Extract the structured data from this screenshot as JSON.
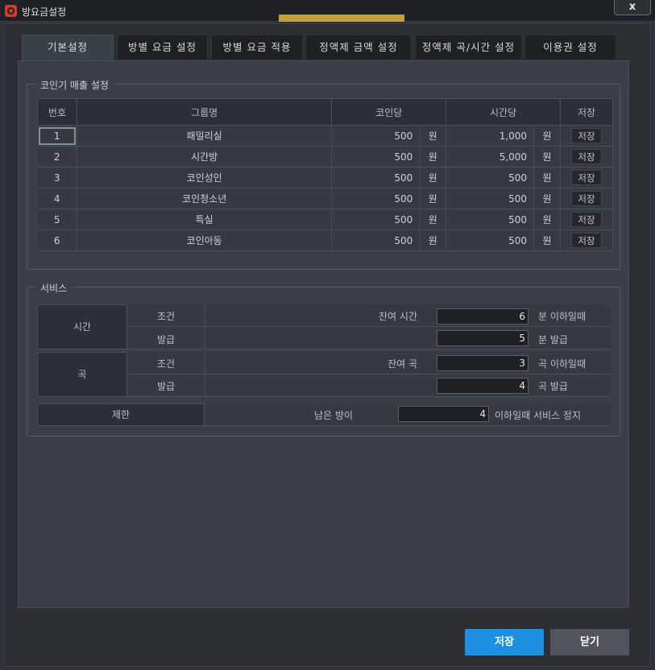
{
  "window": {
    "title": "방요금설정",
    "close_label": "x"
  },
  "tabs": [
    {
      "label": "기본설정"
    },
    {
      "label": "방별 요금 설정"
    },
    {
      "label": "방별 요금 적용"
    },
    {
      "label": "정액제 금액 설정"
    },
    {
      "label": "정액제 곡/시간 설정"
    },
    {
      "label": "이용권 설정"
    }
  ],
  "coin_group": {
    "title": "코인기 매출 설정",
    "headers": {
      "no": "번호",
      "group": "그룹명",
      "per_coin": "코인당",
      "per_time": "시간당",
      "save": "저장"
    },
    "rows": [
      {
        "no": "1",
        "group": "패밀리실",
        "coin": "500",
        "coin_unit": "원",
        "time": "1,000",
        "time_unit": "원",
        "save": "저장"
      },
      {
        "no": "2",
        "group": "시간방",
        "coin": "500",
        "coin_unit": "원",
        "time": "5,000",
        "time_unit": "원",
        "save": "저장"
      },
      {
        "no": "3",
        "group": "코인성인",
        "coin": "500",
        "coin_unit": "원",
        "time": "500",
        "time_unit": "원",
        "save": "저장"
      },
      {
        "no": "4",
        "group": "코인청소년",
        "coin": "500",
        "coin_unit": "원",
        "time": "500",
        "time_unit": "원",
        "save": "저장"
      },
      {
        "no": "5",
        "group": "특실",
        "coin": "500",
        "coin_unit": "원",
        "time": "500",
        "time_unit": "원",
        "save": "저장"
      },
      {
        "no": "6",
        "group": "코인아동",
        "coin": "500",
        "coin_unit": "원",
        "time": "500",
        "time_unit": "원",
        "save": "저장"
      }
    ]
  },
  "service_group": {
    "title": "서비스",
    "time": {
      "label": "시간",
      "cond_label": "조건",
      "cond_text": "잔여 시간",
      "cond_value": "6",
      "cond_suffix": "분 이하일때",
      "issue_label": "발급",
      "issue_value": "5",
      "issue_suffix": "분 발급"
    },
    "song": {
      "label": "곡",
      "cond_label": "조건",
      "cond_text": "잔여 곡",
      "cond_value": "3",
      "cond_suffix": "곡 이하일때",
      "issue_label": "발급",
      "issue_value": "4",
      "issue_suffix": "곡 발급"
    },
    "limit": {
      "label": "제한",
      "text": "남은 방이",
      "value": "4",
      "suffix": "이하일때 서비스 정지"
    }
  },
  "footer": {
    "save_label": "저장",
    "close_label": "닫기"
  },
  "colors": {
    "accent": "#1f8fe0",
    "panel": "#3a3f47",
    "background": "#2b2f34"
  }
}
